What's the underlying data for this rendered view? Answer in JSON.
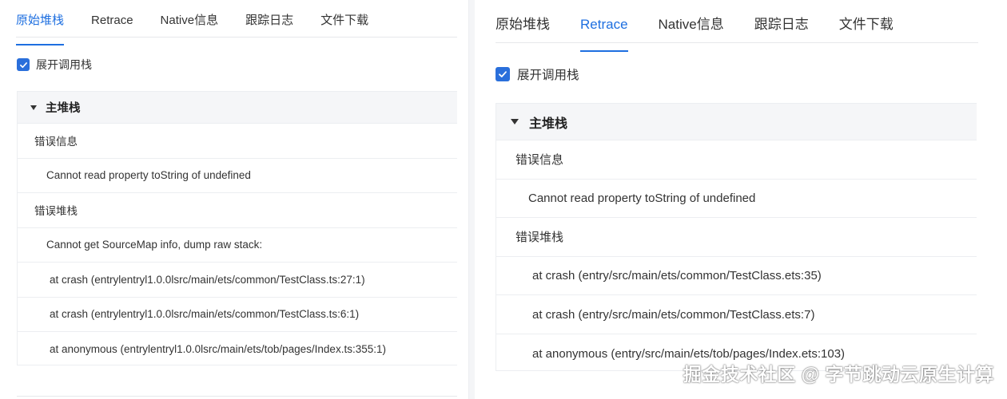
{
  "left_panel": {
    "tabs": [
      {
        "label": "原始堆栈",
        "active": true
      },
      {
        "label": "Retrace",
        "active": false
      },
      {
        "label": "Native信息",
        "active": false
      },
      {
        "label": "跟踪日志",
        "active": false
      },
      {
        "label": "文件下载",
        "active": false
      }
    ],
    "expand_checkbox": {
      "label": "展开调用栈",
      "checked": true
    },
    "stack": {
      "header": "主堆栈",
      "error_info_label": "错误信息",
      "error_message": "Cannot read property toString of undefined",
      "error_stack_label": "错误堆栈",
      "stack_note": "Cannot get SourceMap info, dump raw stack:",
      "frames": [
        "at crash (entrylentryl1.0.0lsrc/main/ets/common/TestClass.ts:27:1)",
        "at crash (entrylentryl1.0.0lsrc/main/ets/common/TestClass.ts:6:1)",
        "at anonymous (entrylentryl1.0.0lsrc/main/ets/tob/pages/Index.ts:355:1)"
      ]
    }
  },
  "right_panel": {
    "tabs": [
      {
        "label": "原始堆栈",
        "active": false
      },
      {
        "label": "Retrace",
        "active": true
      },
      {
        "label": "Native信息",
        "active": false
      },
      {
        "label": "跟踪日志",
        "active": false
      },
      {
        "label": "文件下载",
        "active": false
      }
    ],
    "expand_checkbox": {
      "label": "展开调用栈",
      "checked": true
    },
    "stack": {
      "header": "主堆栈",
      "error_info_label": "错误信息",
      "error_message": "Cannot read property toString of undefined",
      "error_stack_label": "错误堆栈",
      "frames": [
        "at crash (entry/src/main/ets/common/TestClass.ets:35)",
        "at crash (entry/src/main/ets/common/TestClass.ets:7)",
        "at anonymous (entry/src/main/ets/tob/pages/Index.ets:103)"
      ]
    }
  },
  "watermark": "掘金技术社区 @ 字节跳动云原生计算",
  "colors": {
    "accent": "#1e6fe0",
    "checkbox": "#2a6fdb",
    "header_bg": "#f5f6f8",
    "border": "#eceef1"
  }
}
